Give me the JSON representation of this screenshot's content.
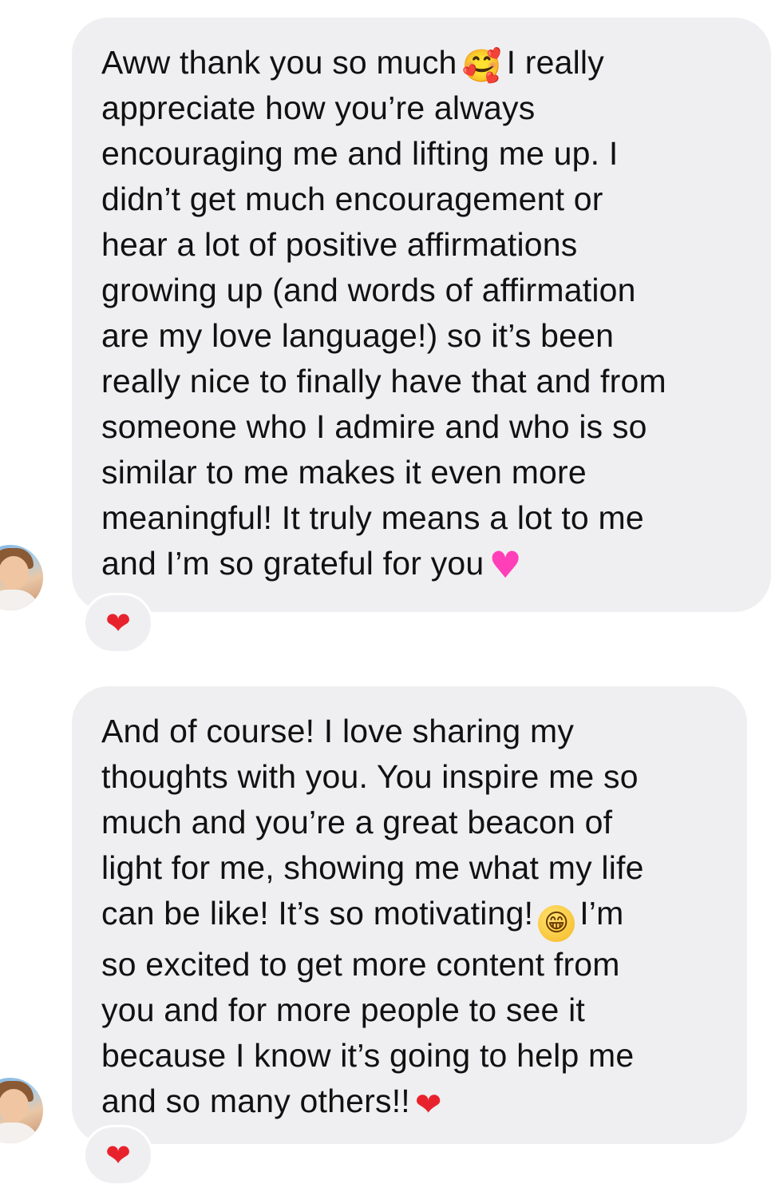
{
  "messages": [
    {
      "lines": [
        "Aww thank you so much",
        "I really",
        "appreciate how you’re always",
        "encouraging me and lifting me up. I",
        "didn’t get much encouragement or",
        "hear a lot of positive affirmations",
        "growing up (and words of affirmation",
        "are my love language!) so it’s been",
        "really nice to finally have that and from",
        "someone who I admire and who is so",
        "similar to me makes it even more",
        "meaningful! It truly means a lot to me",
        "and I’m so grateful for you"
      ],
      "emojis": {
        "smiling_hearts": "🥰",
        "pink_heart": "♥"
      },
      "reaction": "❤"
    },
    {
      "lines": [
        "And of course! I love sharing my",
        "thoughts with you. You inspire me so",
        "much and you’re a great beacon of",
        "light for me, showing me what my life",
        "can be like! It’s so motivating!",
        "I’m",
        "so excited to get more content from",
        "you and for more people to see it",
        "because I know it’s going to help me",
        "and so many others!!"
      ],
      "emojis": {
        "grin": "😁",
        "red_heart": "❤"
      },
      "reaction": "❤"
    }
  ],
  "colors": {
    "bubble": "#efeff1",
    "text": "#111111",
    "red_heart": "#e8222c",
    "pink_heart": "#ff3fb8"
  }
}
